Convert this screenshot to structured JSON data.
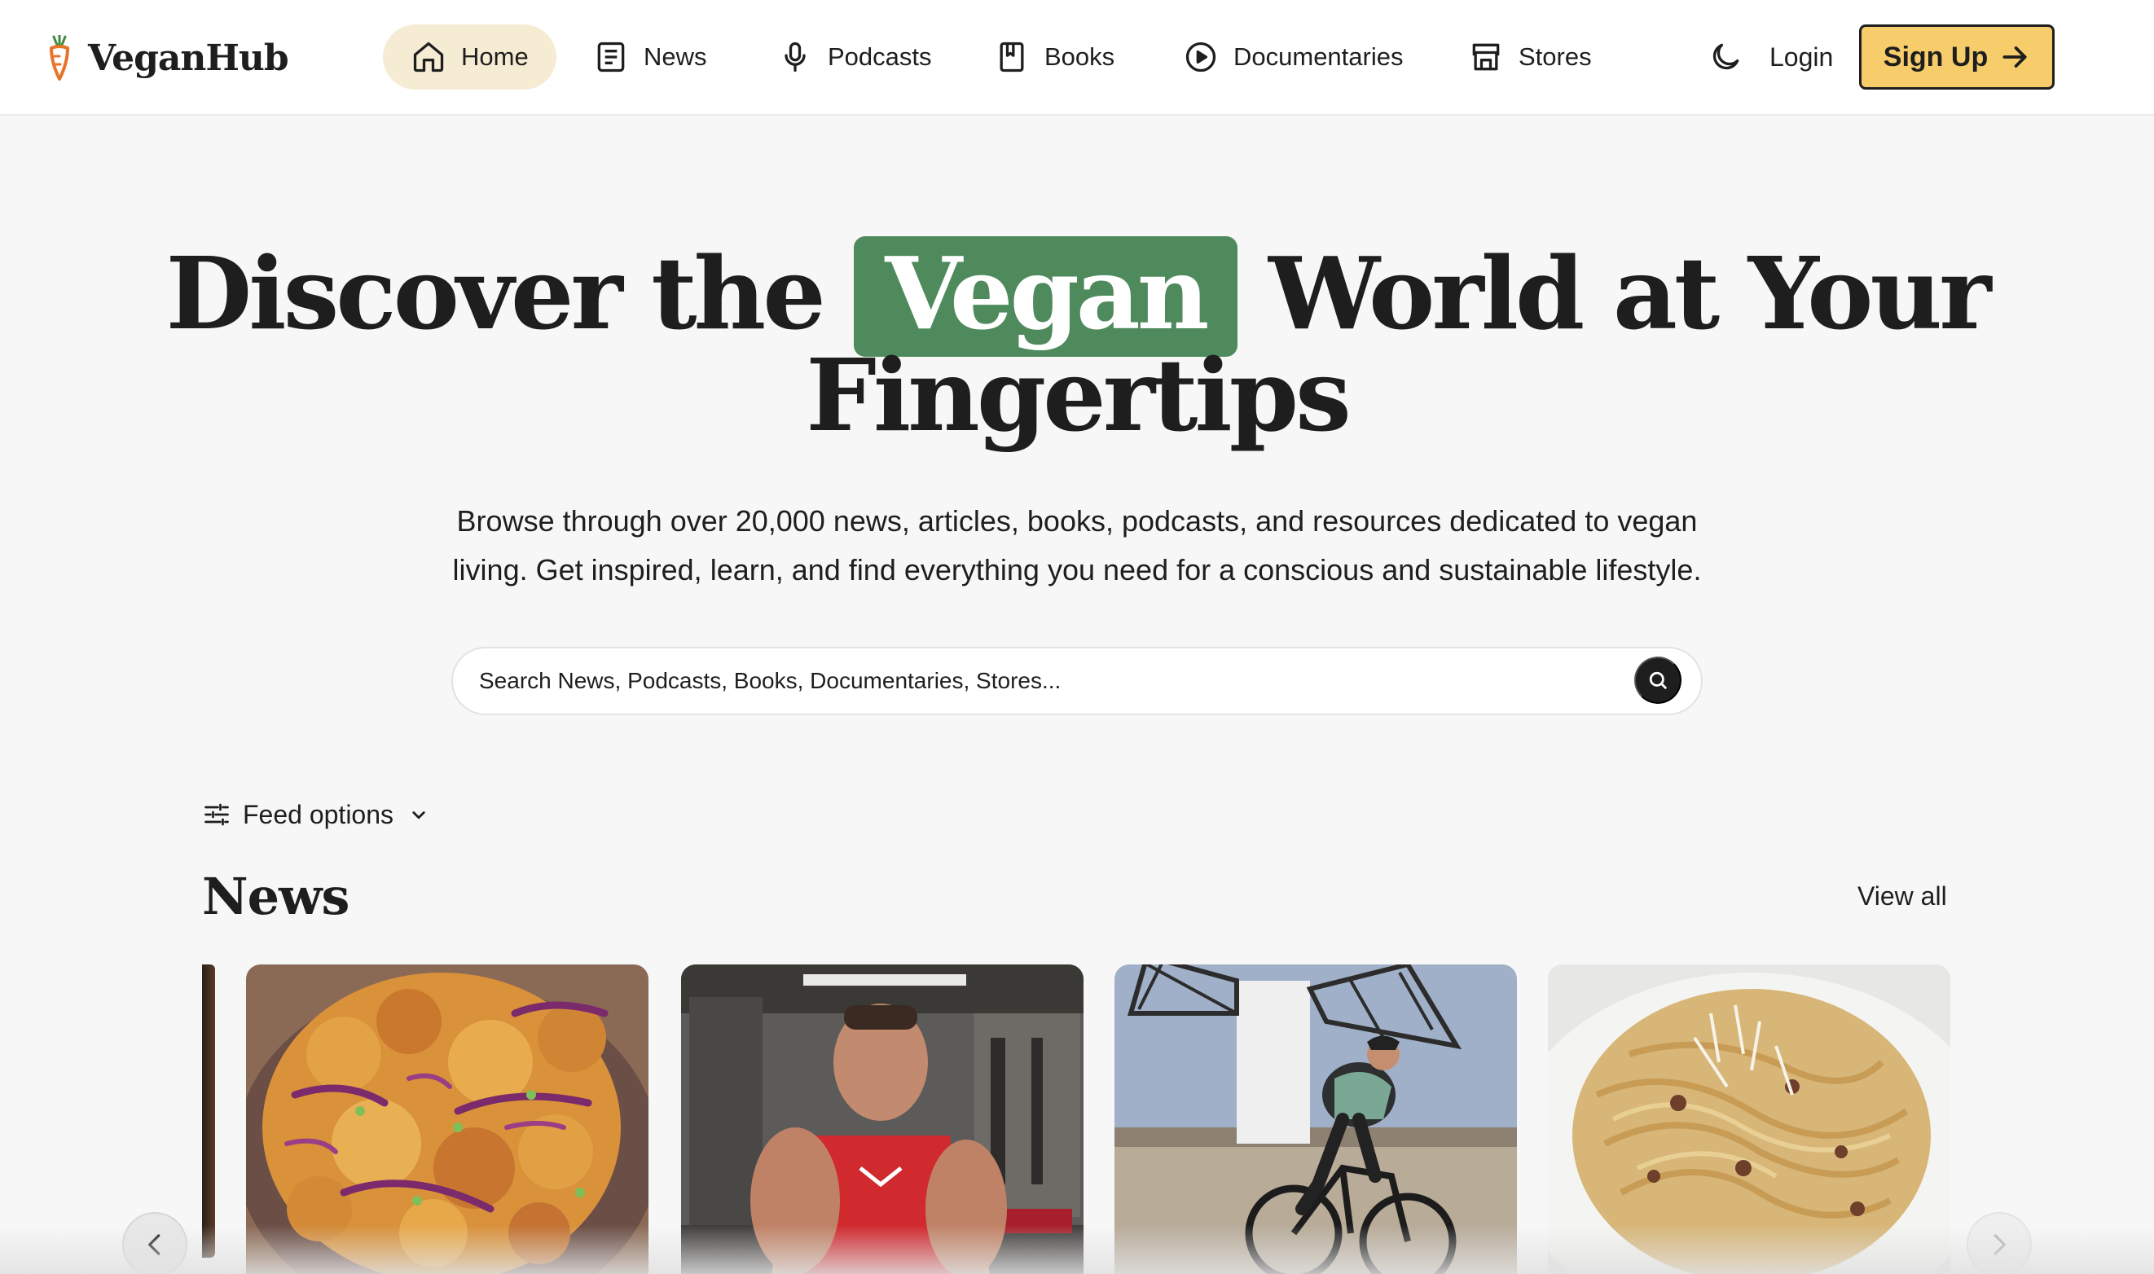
{
  "brand": {
    "name": "VeganHub",
    "accent": "#f6cd6a",
    "highlight": "#4f8a5d",
    "active_nav_bg": "#f6ecd4"
  },
  "nav": {
    "items": [
      {
        "label": "Home",
        "icon": "home-icon",
        "active": true
      },
      {
        "label": "News",
        "icon": "newspaper-icon",
        "active": false
      },
      {
        "label": "Podcasts",
        "icon": "microphone-icon",
        "active": false
      },
      {
        "label": "Books",
        "icon": "book-icon",
        "active": false
      },
      {
        "label": "Documentaries",
        "icon": "play-circle-icon",
        "active": false
      },
      {
        "label": "Stores",
        "icon": "store-icon",
        "active": false
      }
    ],
    "theme_icon": "moon-icon",
    "login_label": "Login",
    "signup_label": "Sign Up"
  },
  "hero": {
    "title_pre": "Discover the",
    "title_highlight": "Vegan",
    "title_post": "World at Your",
    "title_line2": "Fingertips",
    "subtitle_line1": "Browse through over 20,000 news, articles, books, podcasts, and resources dedicated to vegan",
    "subtitle_line2": "living. Get inspired, learn, and find everything you need for a conscious and sustainable lifestyle."
  },
  "search": {
    "placeholder": "Search News, Podcasts, Books, Documentaries, Stores..."
  },
  "feed": {
    "options_label": "Feed options",
    "section_title": "News",
    "view_all_label": "View all",
    "cards": [
      {
        "image": "fried-cauliflower-dish"
      },
      {
        "image": "muscular-man-in-gym"
      },
      {
        "image": "cyclist-by-windmill"
      },
      {
        "image": "pasta-plate"
      }
    ]
  }
}
